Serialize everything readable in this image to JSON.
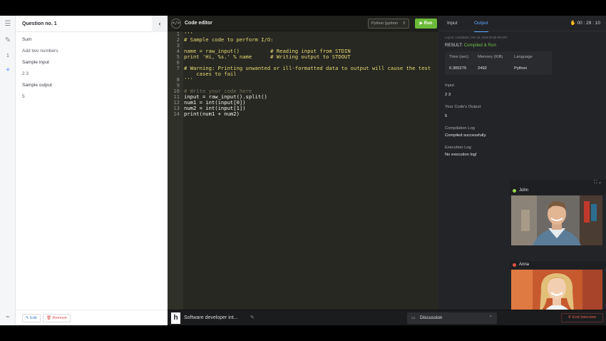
{
  "question": {
    "title": "Question no. 1",
    "number": "1",
    "name": "Sum",
    "description": "Add two numbers",
    "sample_input_label": "Sample input",
    "sample_input": "2 3",
    "sample_output_label": "Sample output",
    "sample_output": "5",
    "edit_label": "Edit",
    "remove_label": "Remove"
  },
  "editor": {
    "title": "Code editor",
    "language": "Python (python",
    "run_label": "Run",
    "lines": [
      {
        "n": "1",
        "text": "'''",
        "cls": "cm"
      },
      {
        "n": "2",
        "text": "# Sample code to perform I/O:",
        "cls": "cm"
      },
      {
        "n": "3",
        "text": "",
        "cls": "cm"
      },
      {
        "n": "4",
        "text": "name = raw_input()          # Reading input from STDIN",
        "cls": "cm"
      },
      {
        "n": "5",
        "text": "print 'Hi, %s.' % name      # Writing output to STDOUT",
        "cls": "cm"
      },
      {
        "n": "6",
        "text": "",
        "cls": "cm"
      },
      {
        "n": "7",
        "text": "# Warning: Printing unwanted or ill-formatted data to output will cause the test",
        "cls": "cm"
      },
      {
        "n": "",
        "text": "    cases to fail",
        "cls": "cm"
      },
      {
        "n": "8",
        "text": "'''",
        "cls": "cm"
      },
      {
        "n": "9",
        "text": "",
        "cls": "cm"
      },
      {
        "n": "10",
        "text": "# Write your code here",
        "cls": "cm2"
      },
      {
        "n": "11",
        "text": "input = raw_input().split()",
        "cls": "tx"
      },
      {
        "n": "12",
        "text": "num1 = int(input[0])",
        "cls": "tx"
      },
      {
        "n": "13",
        "text": "num2 = int(input[1])",
        "cls": "tx"
      },
      {
        "n": "14",
        "text": "print(num1 + num2)",
        "cls": "tx"
      }
    ]
  },
  "output": {
    "tab_input": "Input",
    "tab_output": "Output",
    "timer": "00 : 29 : 10",
    "log_id": "Log ID: 14633626 | Oct 15, 2018 03:09 PM IST",
    "result_label": "RESULT:",
    "result_value": "Compiled & Run",
    "time_label": "Time (sec)",
    "memory_label": "Memory (KiB)",
    "language_label": "Language",
    "time_value": "0.305275",
    "memory_value": "2492",
    "language_value": "Python",
    "input_label": "Input",
    "input_value": "2  3",
    "code_output_label": "Your Code's Output",
    "code_output_value": "5",
    "compilation_label": "Compilation Log",
    "compilation_value": "Compiled successfully.",
    "execution_label": "Execution Log",
    "execution_value": "No execution log!"
  },
  "video": {
    "participant1": "John",
    "participant2": "Anna",
    "participant1_color": "#9bd84a",
    "participant2_color": "#e0563f"
  },
  "footer": {
    "logo": "h",
    "title": "Software developer int...",
    "discussion_label": "Discussion",
    "end_label": "End Interview"
  }
}
